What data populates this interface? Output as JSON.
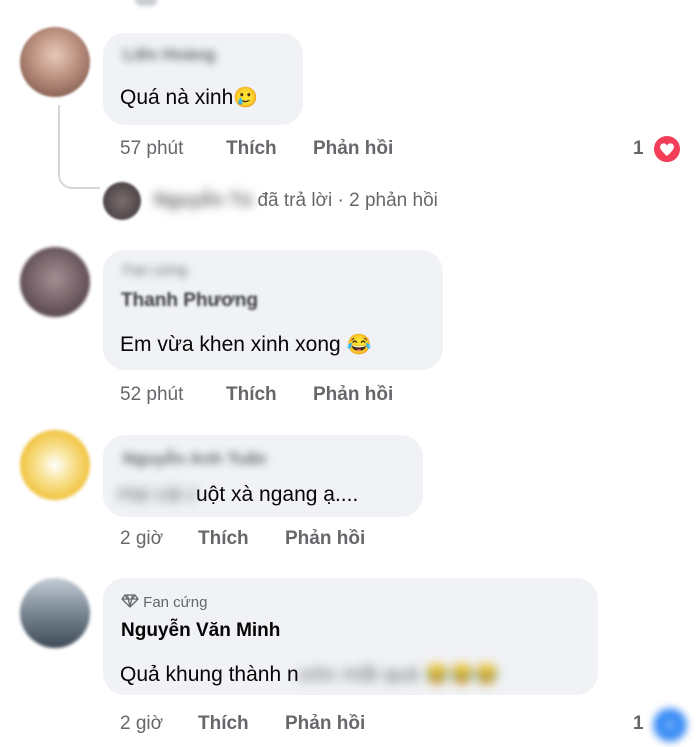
{
  "comments": [
    {
      "author_blurred": "Liên Hoàng",
      "text": "Quá nà xinh",
      "emoji": "🥲",
      "time": "57 phút",
      "like_label": "Thích",
      "reply_label": "Phản hồi",
      "reaction_count": "1",
      "replies_summary": {
        "author_blurred": "Nguyễn Tú",
        "text": "đã trả lời · 2 phản hồi"
      }
    },
    {
      "badge_blurred": "Fan cứng",
      "author": "Thanh Phương",
      "text": "Em vừa khen xinh xong",
      "emoji": "😂",
      "time": "52 phút",
      "like_label": "Thích",
      "reply_label": "Phản hồi"
    },
    {
      "author_blurred": "Nguyễn Anh Tuấn",
      "text_blurred_prefix": "Hai cái đá",
      "text": "uột xà ngang ạ....",
      "time": "2 giờ",
      "like_label": "Thích",
      "reply_label": "Phản hồi"
    },
    {
      "badge": "Fan cứng",
      "author": "Nguyễn Văn Minh",
      "text": "Quả khung thành n",
      "text_blurred_suffix": "ước mắt quá",
      "emoji_blurred": "😂😂😂",
      "time": "2 giờ",
      "like_label": "Thích",
      "reply_label": "Phản hồi",
      "reaction_count": "1"
    }
  ],
  "colors": {
    "bubble": "#f0f2f5",
    "meta_text": "#65676b",
    "love_reaction": "#f33e58",
    "like_reaction": "#1877f2"
  }
}
